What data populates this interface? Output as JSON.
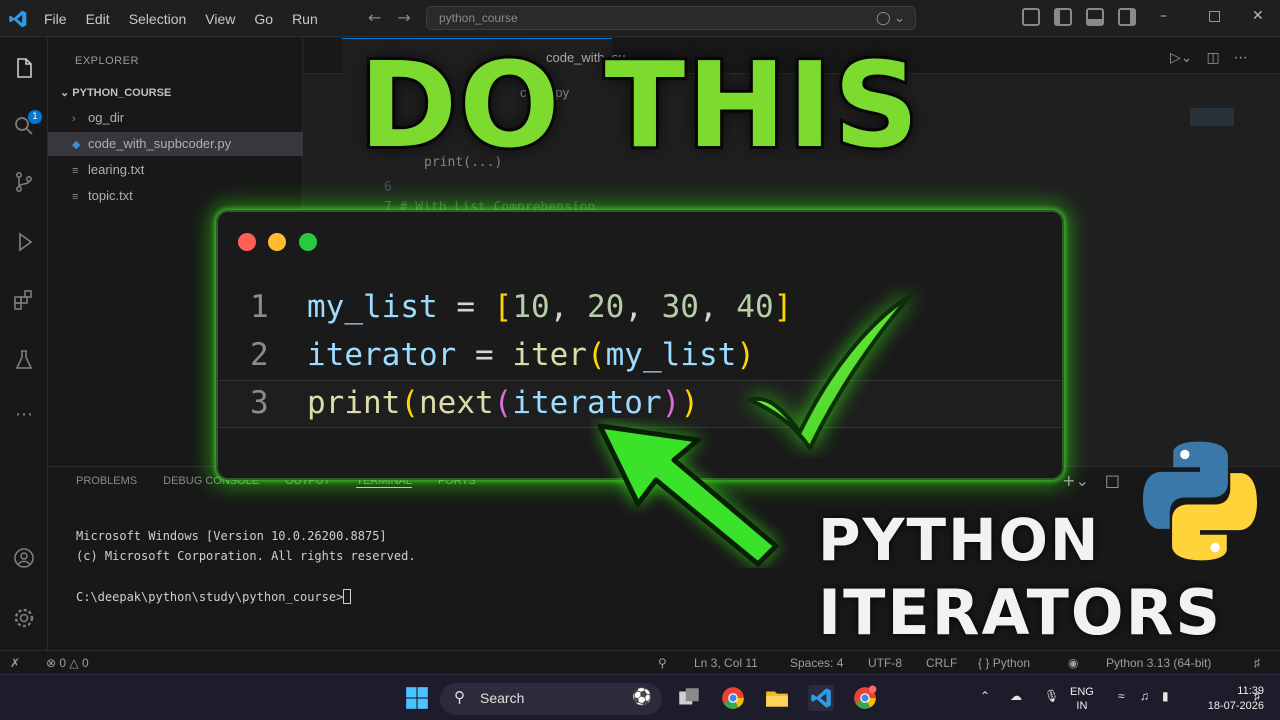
{
  "titlebar": {
    "menu": [
      "File",
      "Edit",
      "Selection",
      "View",
      "Go",
      "Run"
    ],
    "search_placeholder": "python_course"
  },
  "explorer": {
    "title": "EXPLORER",
    "section": "PYTHON_COURSE",
    "items": [
      {
        "label": "og_dir",
        "kind": "folder"
      },
      {
        "label": "code_with_supbcoder.py",
        "kind": "python",
        "active": true
      },
      {
        "label": "learing.txt",
        "kind": "text"
      },
      {
        "label": "topic.txt",
        "kind": "text"
      }
    ]
  },
  "editor": {
    "tab_label": "code_with_su",
    "breadcrumb": "coder.py",
    "bg_lines": [
      {
        "text": "print(...)",
        "color": "#dcdcaa"
      },
      {
        "text": "6",
        "color": "#6e7681"
      },
      {
        "text": "7    # With List Comprehension",
        "color": "#6a9955"
      }
    ]
  },
  "panel": {
    "tabs": [
      "PROBLEMS",
      "DEBUG CONSOLE",
      "OUTPUT",
      "TERMINAL",
      "PORTS"
    ],
    "terminal_lines": [
      "Microsoft Windows [Version 10.0.26200.8875]",
      "(c) Microsoft Corporation. All rights reserved.",
      "",
      "C:\\deepak\\python\\study\\python_course>"
    ]
  },
  "statusbar": {
    "problems": "0",
    "warnings": "0",
    "position": "Ln 3, Col 11",
    "spaces": "Spaces: 4",
    "encoding": "UTF-8",
    "eol": "CRLF",
    "language": "Python",
    "interpreter": "Python 3.13 (64-bit)"
  },
  "overlay": {
    "headline": "DO THIS",
    "code_lines": [
      {
        "n": "1",
        "text": "my_list = [10, 20, 30, 40]"
      },
      {
        "n": "2",
        "text": "iterator = iter(my_list)"
      },
      {
        "n": "3",
        "text": "print(next(iterator))"
      }
    ],
    "subtitle_line1": "PYTHON",
    "subtitle_line2": "ITERATORS",
    "accent_color": "#7ddb2f",
    "glow_color": "#39ff14"
  },
  "taskbar": {
    "search_label": "Search",
    "lang_line1": "ENG",
    "lang_line2": "IN",
    "time": "11:39",
    "date": "18-07-2026"
  }
}
